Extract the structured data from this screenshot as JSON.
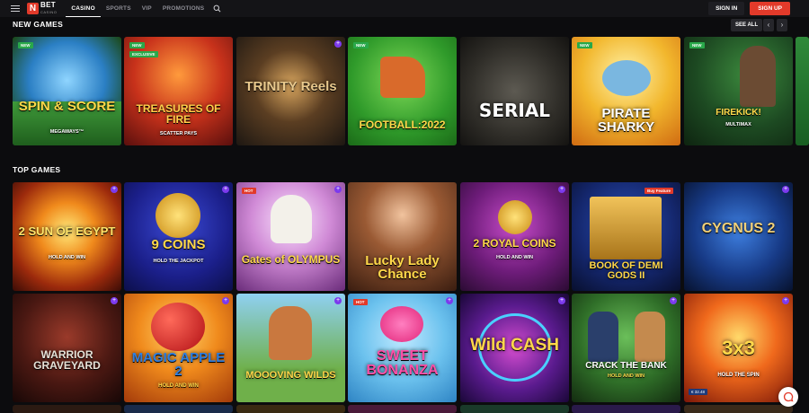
{
  "brand": {
    "logo_letter": "N",
    "logo_text": "BET",
    "logo_sub": "CASINO",
    "accent": "#e23a2a"
  },
  "nav": {
    "items": [
      {
        "label": "CASINO",
        "active": true
      },
      {
        "label": "SPORTS",
        "active": false
      },
      {
        "label": "VIP",
        "active": false
      },
      {
        "label": "PROMOTIONS",
        "active": false
      }
    ]
  },
  "header": {
    "sign_in": "SIGN IN",
    "sign_up": "SIGN UP"
  },
  "new_games": {
    "title": "NEW GAMES",
    "see_all": "SEE ALL",
    "prev_icon": "chevron-left-icon",
    "next_icon": "chevron-right-icon",
    "tiles": [
      {
        "name": "SPIN & SCORE",
        "sub": "MEGAWAYS™",
        "badge": "NEW"
      },
      {
        "name": "TREASURES OF FIRE",
        "sub": "SCATTER PAYS",
        "badge": "NEW",
        "badge2": "EXCLUSIVE"
      },
      {
        "name": "TRINITY Reels",
        "sub": ""
      },
      {
        "name": "FOOTBALL:2022",
        "sub": "",
        "badge": "NEW"
      },
      {
        "name": "SERIAL",
        "sub": ""
      },
      {
        "name": "PIRATE SHARKY",
        "sub": "",
        "badge": "NEW"
      },
      {
        "name": "FIREKICK!",
        "sub": "MULTIMAX",
        "badge": "NEW"
      }
    ]
  },
  "top_games": {
    "title": "TOP GAMES",
    "tiles": [
      {
        "name": "2 SUN OF EGYPT",
        "sub": "HOLD AND WIN"
      },
      {
        "name": "9 COINS",
        "sub": "HOLD THE JACKPOT"
      },
      {
        "name": "Gates of OLYMPUS",
        "sub": "",
        "badge": "HOT"
      },
      {
        "name": "Lucky Lady Chance",
        "sub": ""
      },
      {
        "name": "2 ROYAL COINS",
        "sub": "HOLD AND WIN"
      },
      {
        "name": "BOOK OF DEMI GODS II",
        "sub": "Buy Feature"
      },
      {
        "name": "CYGNUS 2",
        "sub": ""
      },
      {
        "name": "WARRIOR GRAVEYARD",
        "sub": ""
      },
      {
        "name": "MAGIC APPLE 2",
        "sub": "HOLD AND WIN"
      },
      {
        "name": "MOOOVING WILDS",
        "sub": ""
      },
      {
        "name": "SWEET BONANZA",
        "sub": "",
        "badge": "HOT"
      },
      {
        "name": "Wild CASH",
        "sub": ""
      },
      {
        "name": "CRACK THE BANK",
        "sub": "HOLD AND WIN"
      },
      {
        "name": "3x3",
        "sub": "HOLD THE SPIN",
        "price": "€ 32.48"
      }
    ]
  }
}
